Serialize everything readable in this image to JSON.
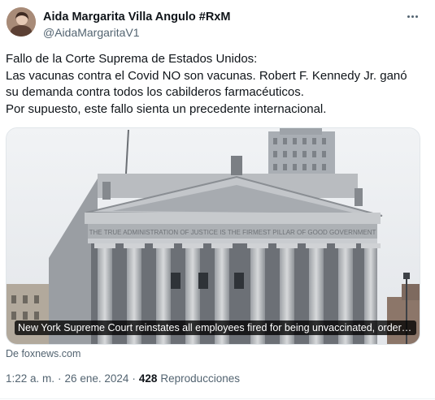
{
  "author": {
    "display_name": "Aida Margarita Villa Angulo #RxM",
    "handle": "@AidaMargaritaV1"
  },
  "tweet": {
    "text": "Fallo de la Corte Suprema de Estados Unidos:\nLas vacunas contra el Covid NO son vacunas. Robert F. Kennedy Jr. ganó su demanda contra todos los cabilderos farmacéuticos.\nPor supuesto, este fallo sienta un precedente internacional."
  },
  "card": {
    "headline": "New York Supreme Court reinstates all employees fired for being unvaccinated, orders b...",
    "source": "De foxnews.com",
    "facade_inscription": "THE TRUE ADMINISTRATION OF JUSTICE IS THE FIRMEST PILLAR OF GOOD GOVERNMENT"
  },
  "meta": {
    "time": "1:22 a. m.",
    "sep1": "·",
    "date": "26 ene. 2024",
    "sep2": "·",
    "views_count": "428",
    "views_label": "Reproducciones"
  },
  "icons": {
    "more": "more-horizontal-icon"
  }
}
